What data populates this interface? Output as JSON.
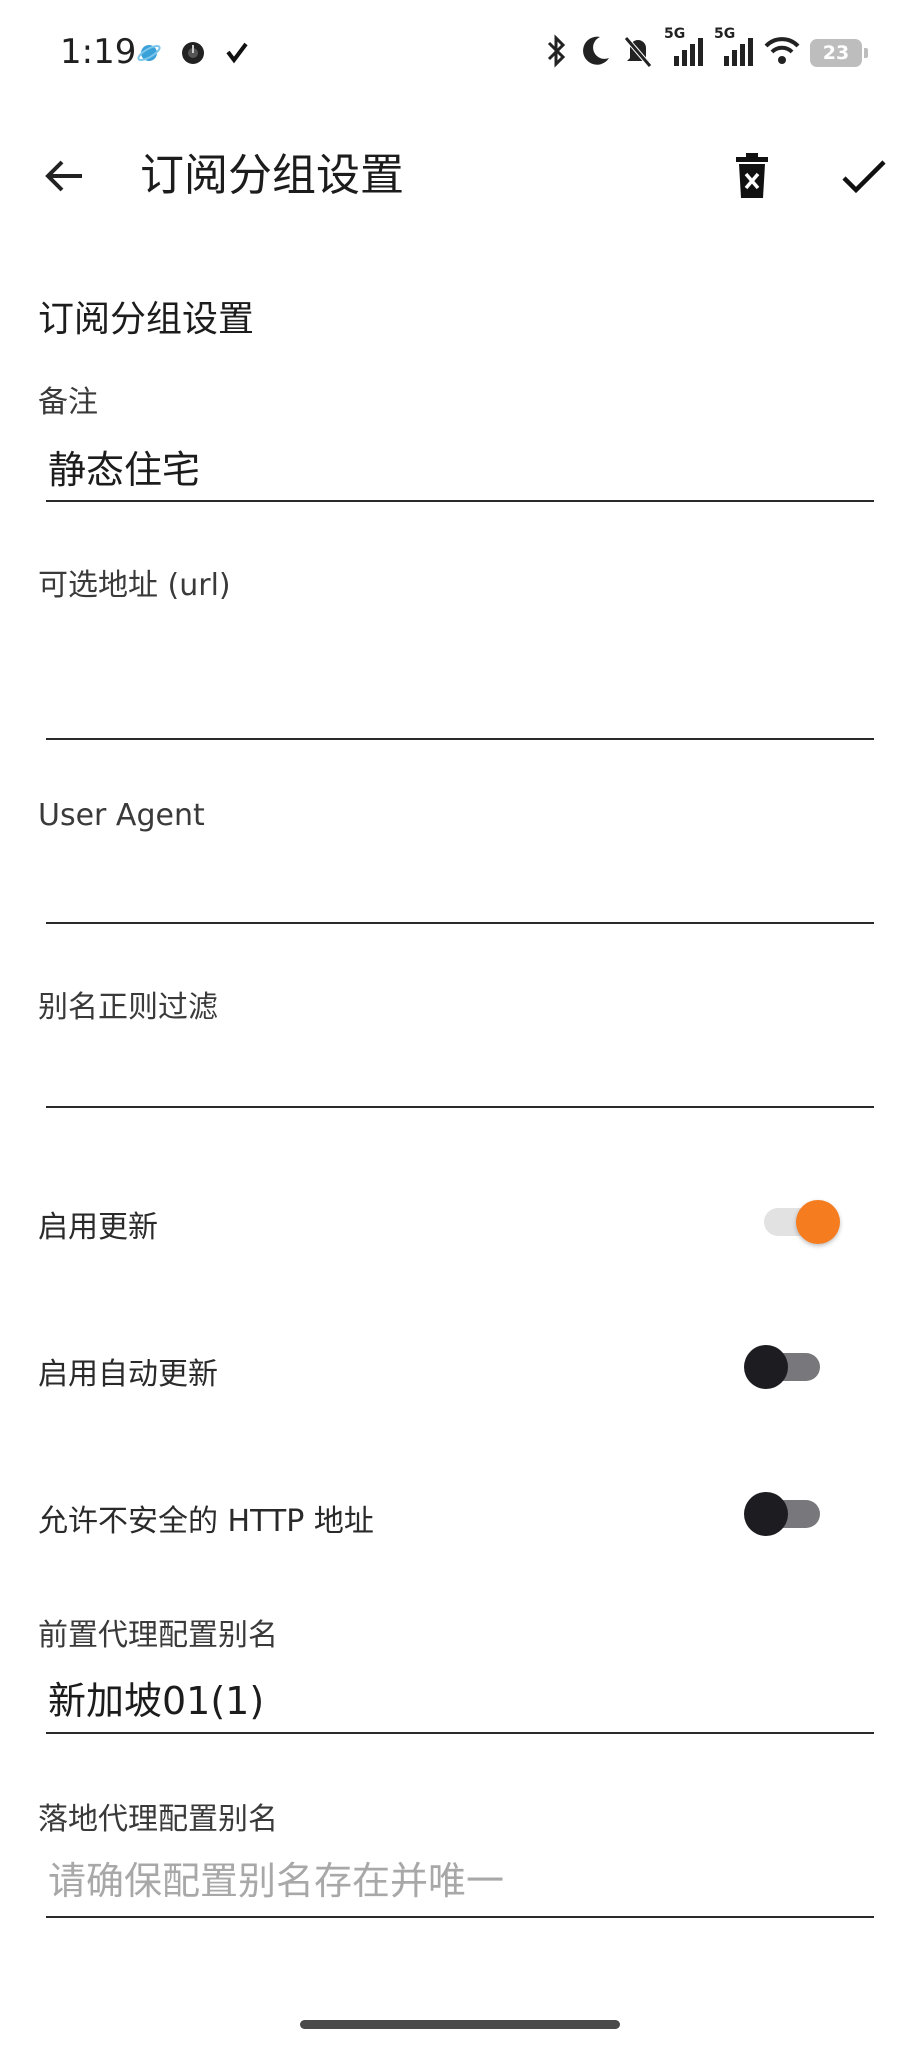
{
  "status_bar": {
    "time": "1:19",
    "network_1": "5G",
    "network_2": "5G",
    "battery": "23",
    "icons": [
      "app-planet-icon",
      "app-dark-circle-icon",
      "app-check-icon",
      "bluetooth-icon",
      "do-not-disturb-moon-icon",
      "bell-muted-icon",
      "signal-icon",
      "signal-icon",
      "wifi-icon",
      "battery-icon"
    ]
  },
  "app_bar": {
    "title": "订阅分组设置",
    "back_icon": "arrow-back-icon",
    "delete_icon": "delete-icon",
    "confirm_icon": "check-icon"
  },
  "form": {
    "section_title": "订阅分组设置",
    "remark": {
      "label": "备注",
      "value": "静态住宅"
    },
    "url": {
      "label": "可选地址 (url)",
      "value": ""
    },
    "user_agent": {
      "label": "User Agent",
      "value": ""
    },
    "alias_filter": {
      "label": "别名正则过滤",
      "value": ""
    },
    "enable_update": {
      "label": "启用更新",
      "checked": true
    },
    "enable_auto_update": {
      "label": "启用自动更新",
      "checked": false
    },
    "allow_insecure_http": {
      "label": "允许不安全的 HTTP 地址",
      "checked": false
    },
    "front_proxy": {
      "label": "前置代理配置别名",
      "value": "新加坡01(1)"
    },
    "landing_proxy": {
      "label": "落地代理配置别名",
      "placeholder": "请确保配置别名存在并唯一",
      "value": ""
    }
  },
  "colors": {
    "accent": "#f57c1f",
    "switch_off_track": "#78777c",
    "switch_off_thumb": "#1d1c21"
  }
}
